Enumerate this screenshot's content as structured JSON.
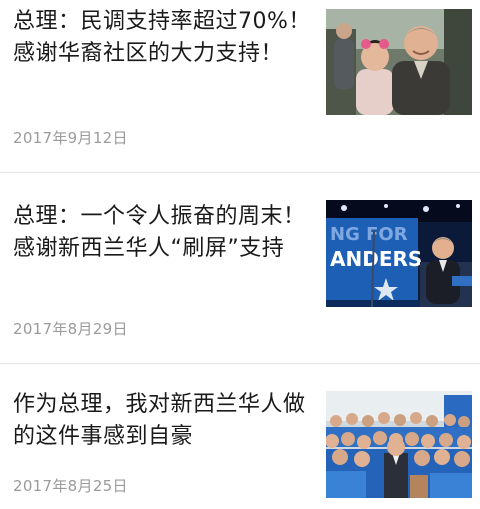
{
  "articles": [
    {
      "title": "总理：民调支持率超过70%！感谢华裔社区的大力支持！",
      "date": "2017年9月12日",
      "thumbnail": "pm-with-child-photo"
    },
    {
      "title": "总理：一个令人振奋的周末！感谢新西兰华人“刷屏”支持",
      "date": "2017年8月29日",
      "thumbnail": "campaign-stage-photo"
    },
    {
      "title": "作为总理，我对新西兰华人做的这件事感到自豪",
      "date": "2017年8月25日",
      "thumbnail": "supporters-group-photo"
    }
  ],
  "thumbnail_text": {
    "stage_banner_line1": "NG FOR",
    "stage_banner_line2": "ANDERS"
  },
  "colors": {
    "title": "#1a1a1a",
    "date": "#9b9b9b",
    "divider": "#e6e6e6",
    "campaign_blue": "#1d5fb4"
  }
}
